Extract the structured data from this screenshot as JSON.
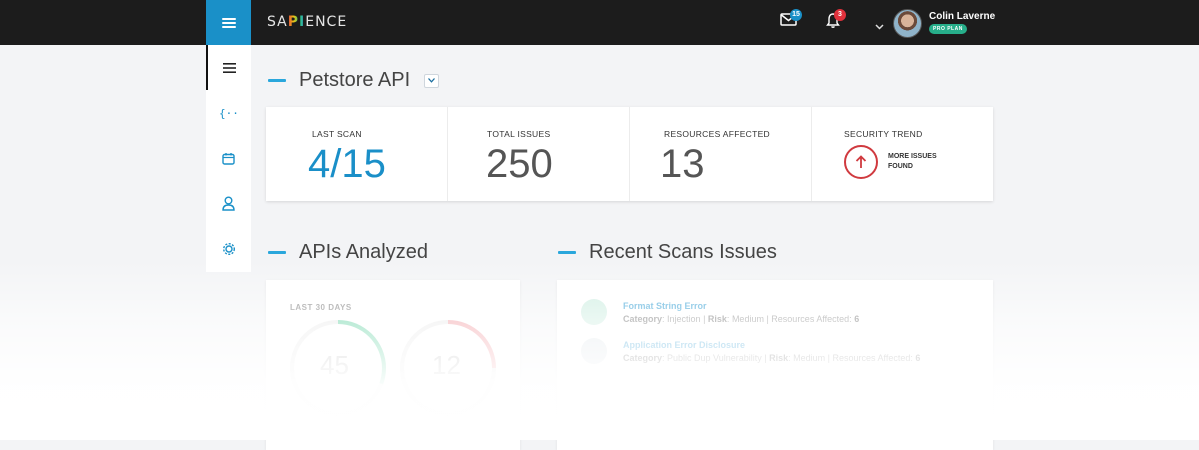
{
  "topbar": {
    "logo_pre": "SA",
    "logo_api": "PI",
    "logo_post": "ENCE",
    "messages_count": "15",
    "notifications_count": "3",
    "user_name": "Colin Laverne",
    "plan_label": "PRO PLAN"
  },
  "header": {
    "title": "Petstore API"
  },
  "stats": {
    "last_scan_label": "LAST SCAN",
    "last_scan_value": "4/15",
    "total_issues_label": "TOTAL ISSUES",
    "total_issues_value": "250",
    "resources_label": "RESOURCES AFFECTED",
    "resources_value": "13",
    "trend_label": "SECURITY TREND",
    "trend_line1": "MORE ISSUES",
    "trend_line2": "FOUND"
  },
  "apis": {
    "title": "APIs Analyzed",
    "period_label": "LAST 30 DAYS",
    "gauge1_value": "45",
    "gauge2_value": "12"
  },
  "scans": {
    "title": "Recent Scans Issues",
    "items": [
      {
        "title": "Format String Error",
        "category_label": "Category",
        "category": "Injection",
        "risk_label": "Risk",
        "risk": "Medium",
        "resources_label": "Resources Affected:",
        "resources": "6"
      },
      {
        "title": "Application Error Disclosure",
        "category_label": "Category",
        "category": "Public Dup Vulnerability",
        "risk_label": "Risk",
        "risk": "Medium",
        "resources_label": "Resources Affected:",
        "resources": "6"
      }
    ]
  },
  "colors": {
    "accent": "#1a90c8",
    "danger": "#d03a3f",
    "success": "#27ae8a",
    "topbar": "#1c1c1c"
  }
}
